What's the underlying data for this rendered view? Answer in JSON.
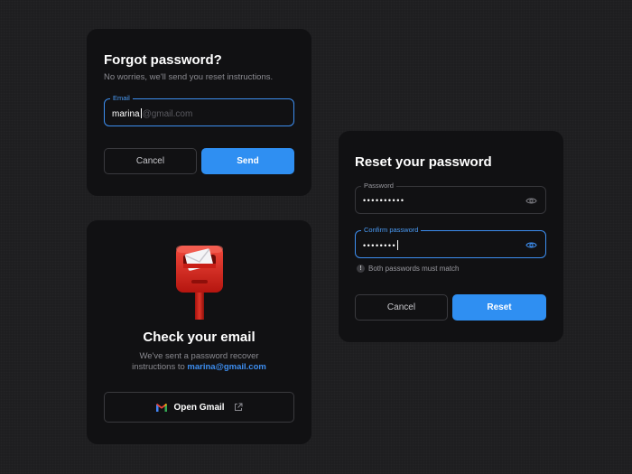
{
  "forgot": {
    "title": "Forgot password?",
    "subtitle": "No worries, we'll send you reset instructions.",
    "email_label": "Email",
    "email_value": "marina",
    "email_ghost": "@gmail.com",
    "cancel_label": "Cancel",
    "send_label": "Send"
  },
  "check": {
    "title": "Check your email",
    "body_line1": "We've sent a password recover",
    "body_line2_prefix": "instructions to ",
    "email": "marina@gmail.com",
    "open_gmail_label": "Open Gmail"
  },
  "reset": {
    "title": "Reset your password",
    "password_label": "Password",
    "password_value": "••••••••••",
    "confirm_label": "Confirm password",
    "confirm_value": "••••••••",
    "helper": "Both passwords must match",
    "cancel_label": "Cancel",
    "reset_label": "Reset"
  },
  "icons": {
    "mailbox": "mailbox-icon",
    "gmail": "gmail-icon",
    "external": "external-link-icon",
    "eye": "eye-icon",
    "alert": "alert-icon"
  },
  "colors": {
    "accent": "#2f8ff2",
    "card": "#111113",
    "background": "#1e1e20"
  }
}
